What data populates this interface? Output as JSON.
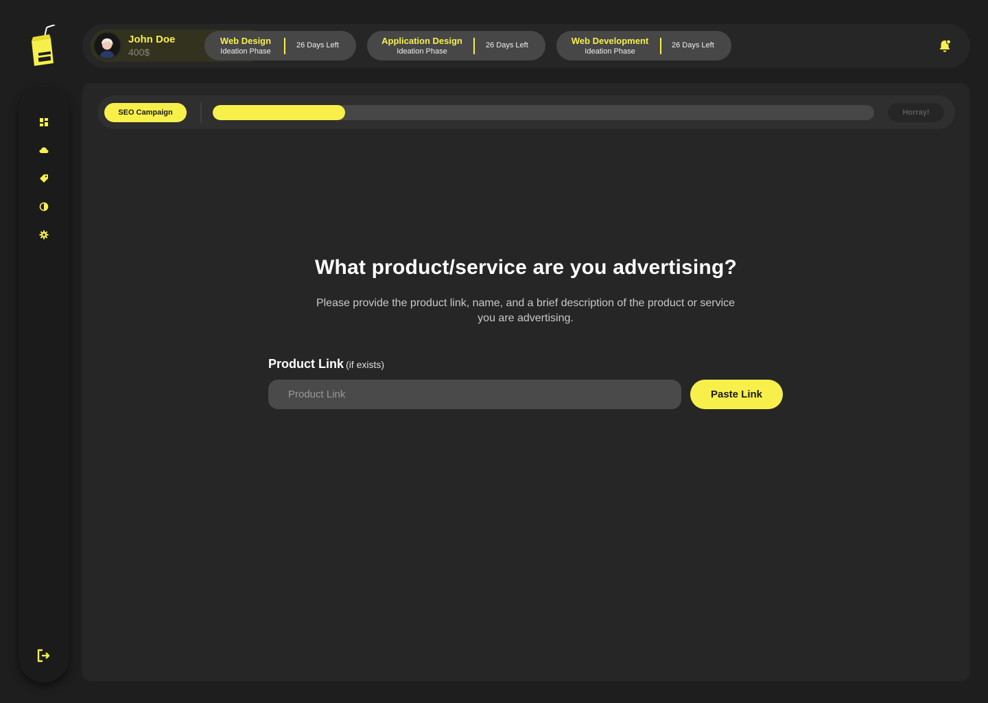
{
  "brand": {
    "logo_text": "JUICE BOX",
    "accent_color": "#f8f04a"
  },
  "sidebar": {
    "items": [
      {
        "name": "dashboard",
        "icon": "dashboard-icon"
      },
      {
        "name": "cloud",
        "icon": "cloud-icon"
      },
      {
        "name": "tags",
        "icon": "tag-icon"
      },
      {
        "name": "theme",
        "icon": "contrast-icon"
      },
      {
        "name": "settings",
        "icon": "gear-icon"
      }
    ],
    "logout_icon": "logout-icon"
  },
  "user": {
    "name": "John Doe",
    "balance": "400$"
  },
  "projects": [
    {
      "title": "Web Design",
      "phase": "Ideation Phase",
      "days_left": "26 Days Left"
    },
    {
      "title": "Application Design",
      "phase": "Ideation Phase",
      "days_left": "26 Days Left"
    },
    {
      "title": "Web Development",
      "phase": "Ideation Phase",
      "days_left": "26 Days Left"
    }
  ],
  "notifications": {
    "icon": "bell-icon"
  },
  "campaign": {
    "label": "SEO Campaign",
    "progress": 0.2,
    "end_label": "Horray!"
  },
  "form": {
    "question": "What product/service are you advertising?",
    "subtitle": "Please provide the product link, name, and a brief description of the product or service you are advertising.",
    "field_label": "Product Link",
    "field_hint": "(if exists)",
    "input_placeholder": "Product Link",
    "input_value": "",
    "paste_button": "Paste Link"
  }
}
